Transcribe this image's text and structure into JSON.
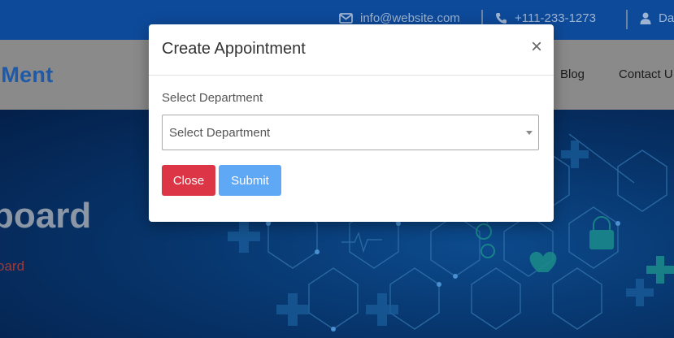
{
  "topbar": {
    "email": "info@website.com",
    "phone": "+111-233-1273",
    "user": "Da",
    "icons": [
      "envelope-icon",
      "phone-icon",
      "user-icon"
    ]
  },
  "navbar": {
    "brand": "cMent",
    "links": [
      "Blog",
      "Contact U"
    ]
  },
  "hero": {
    "title": "board",
    "breadcrumb": "oard"
  },
  "modal": {
    "title": "Create Appointment",
    "close_symbol": "×",
    "field_label": "Select Department",
    "select_value": "Select Department",
    "close_button": "Close",
    "submit_button": "Submit"
  },
  "colors": {
    "topbar": "#0d4a9a",
    "brand": "#1e5aa8",
    "close_button": "#dc3545",
    "submit_button": "#5fa8f6",
    "breadcrumb": "#9c3b3b"
  }
}
